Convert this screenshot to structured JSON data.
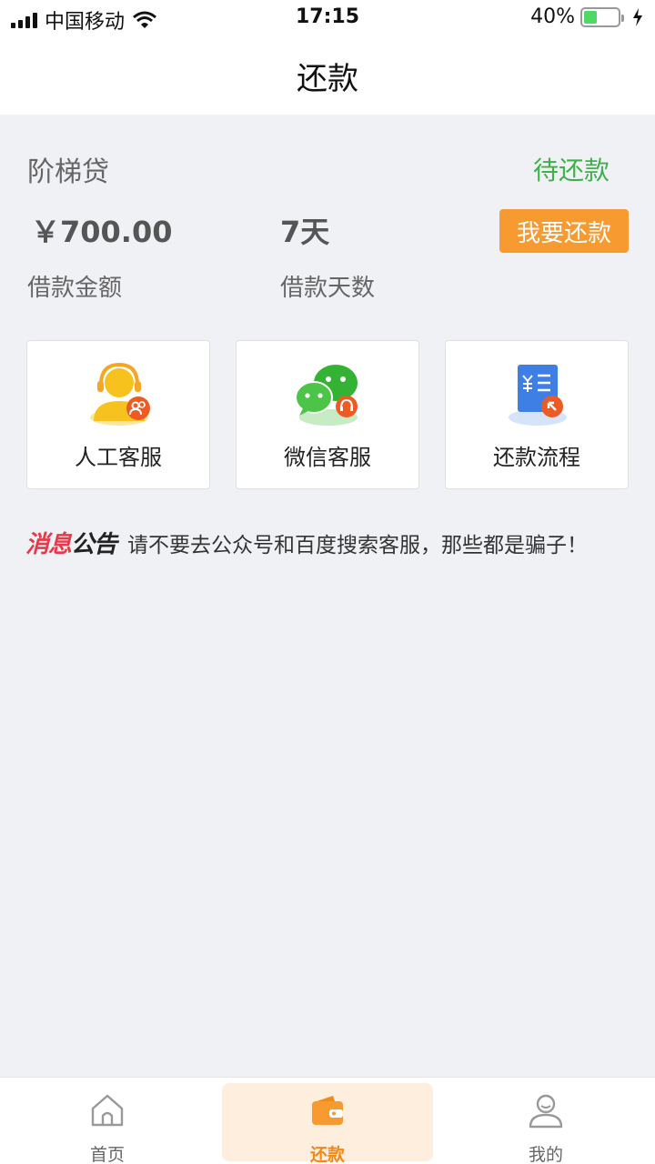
{
  "status_bar": {
    "carrier": "中国移动",
    "time": "17:15",
    "battery": "40%",
    "battery_level": 0.4
  },
  "nav": {
    "title": "还款"
  },
  "loan": {
    "name": "阶梯贷",
    "status": "待还款",
    "amount": "￥700.00",
    "amount_label": "借款金额",
    "days": "7天",
    "days_label": "借款天数",
    "repay_button": "我要还款"
  },
  "services": [
    {
      "label": "人工客服",
      "icon": "customer-service-icon"
    },
    {
      "label": "微信客服",
      "icon": "wechat-icon"
    },
    {
      "label": "还款流程",
      "icon": "repayment-process-icon"
    }
  ],
  "notice": {
    "tag_part1": "消息",
    "tag_part2": "公告",
    "text": "请不要去公众号和百度搜索客服，那些都是骗子！"
  },
  "tabs": [
    {
      "label": "首页",
      "icon": "home-icon"
    },
    {
      "label": "还款",
      "icon": "wallet-icon",
      "active": true
    },
    {
      "label": "我的",
      "icon": "user-icon"
    }
  ],
  "colors": {
    "accent": "#f79a2f",
    "status_green": "#3fb04a",
    "notice_red": "#e8394a",
    "background": "#f0f1f5"
  }
}
